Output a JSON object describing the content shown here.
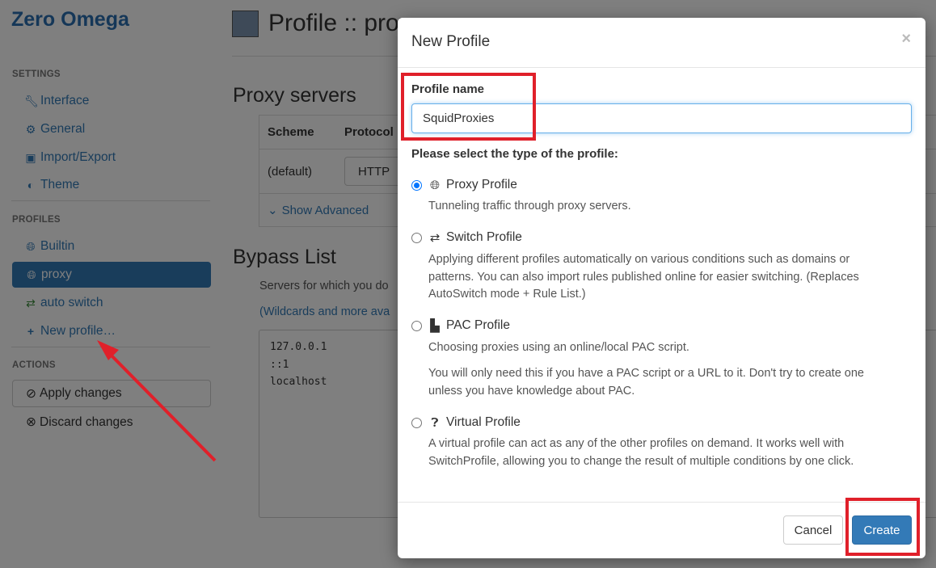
{
  "app": {
    "brand": "Zero Omega"
  },
  "sidebar": {
    "settings_title": "SETTINGS",
    "settings_items": [
      {
        "label": "Interface",
        "icon": "wrench-icon"
      },
      {
        "label": "General",
        "icon": "gear-icon"
      },
      {
        "label": "Import/Export",
        "icon": "floppy-icon"
      },
      {
        "label": "Theme",
        "icon": "contrast-icon"
      }
    ],
    "profiles_title": "PROFILES",
    "profile_items": [
      {
        "label": "Builtin",
        "icon": "globe-icon"
      },
      {
        "label": "proxy",
        "icon": "globe-icon",
        "active": true
      },
      {
        "label": "auto switch",
        "icon": "retweet-icon"
      },
      {
        "label": "New profile…",
        "icon": "plus-icon"
      }
    ],
    "actions_title": "ACTIONS",
    "apply_label": "Apply changes",
    "discard_label": "Discard changes"
  },
  "main": {
    "title": "Profile :: proxy",
    "proxy_heading": "Proxy servers",
    "table_headers": [
      "Scheme",
      "Protocol"
    ],
    "row_scheme": "(default)",
    "row_protocol": "HTTP",
    "show_advanced": "Show Advanced",
    "bypass_heading": "Bypass List",
    "bypass_desc": "Servers for which you do",
    "bypass_link": "(Wildcards and more ava",
    "bypass_lines": [
      "127.0.0.1",
      "::1",
      "localhost"
    ]
  },
  "modal": {
    "title": "New Profile",
    "close": "×",
    "name_label": "Profile name",
    "name_value": "SquidProxies",
    "type_label": "Please select the type of the profile:",
    "options": [
      {
        "label": "Proxy Profile",
        "icon": "globe-icon",
        "checked": true,
        "desc": "Tunneling traffic through proxy servers."
      },
      {
        "label": "Switch Profile",
        "icon": "retweet-icon",
        "checked": false,
        "desc": "Applying different profiles automatically on various conditions such as domains or patterns. You can also import rules published online for easier switching. (Replaces AutoSwitch mode + Rule List.)"
      },
      {
        "label": "PAC Profile",
        "icon": "file-icon",
        "checked": false,
        "desc": "Choosing proxies using an online/local PAC script.",
        "desc2": "You will only need this if you have a PAC script or a URL to it. Don't try to create one unless you have knowledge about PAC."
      },
      {
        "label": "Virtual Profile",
        "icon": "question-icon",
        "checked": false,
        "desc": "A virtual profile can act as any of the other profiles on demand. It works well with SwitchProfile, allowing you to change the result of multiple conditions by one click."
      }
    ],
    "cancel_label": "Cancel",
    "create_label": "Create"
  },
  "colors": {
    "accent": "#337ab7",
    "highlight": "#e0202a",
    "profile_color": "#7c95b0"
  }
}
